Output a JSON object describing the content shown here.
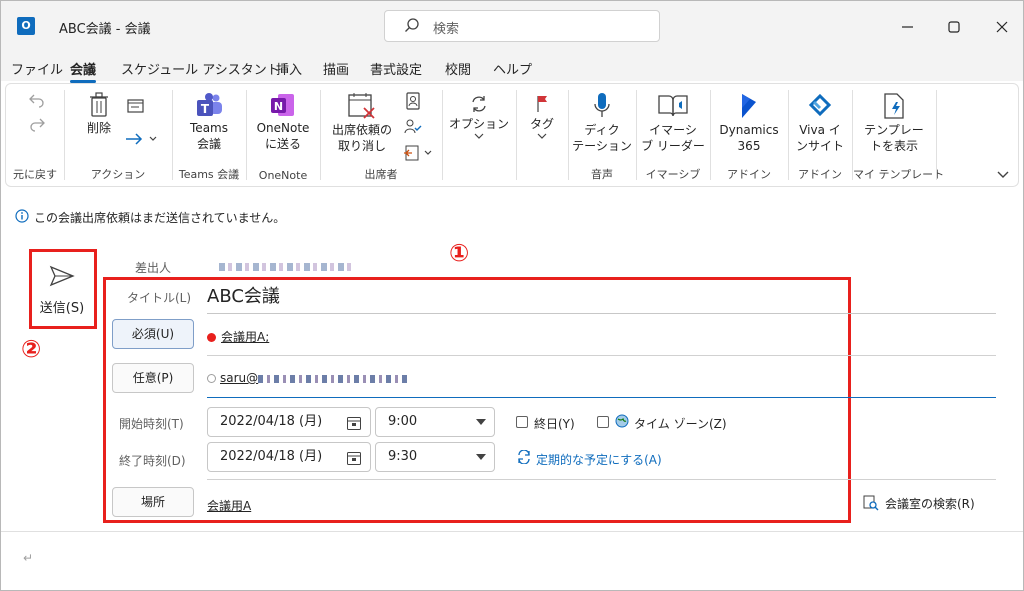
{
  "window": {
    "title": "ABC会議 - 会議",
    "search_placeholder": "検索",
    "app_icon_letter": "O"
  },
  "menu": {
    "tabs": [
      "ファイル",
      "会議",
      "スケジュール アシスタント",
      "挿入",
      "描画",
      "書式設定",
      "校閲",
      "ヘルプ"
    ],
    "active": "会議"
  },
  "ribbon": {
    "groups": {
      "undo": "元に戻す",
      "action": "アクション",
      "teams": "Teams 会議",
      "onenote": "OneNote",
      "attendees": "出席者",
      "voice": "音声",
      "immersive": "イマーシブ",
      "addin1": "アドイン",
      "addin2": "アドイン",
      "mytemplates": "マイ テンプレート"
    },
    "buttons": {
      "delete": "削除",
      "teams_line1": "Teams",
      "teams_line2": "会議",
      "onenote_line1": "OneNote",
      "onenote_line2": "に送る",
      "cancel_invite_line1": "出席依頼の",
      "cancel_invite_line2": "取り消し",
      "options": "オプション",
      "tags": "タグ",
      "dictate_line1": "ディク",
      "dictate_line2": "テーション",
      "immersive_line1": "イマーシ",
      "immersive_line2": "ブ リーダー",
      "dynamics_line1": "Dynamics",
      "dynamics_line2": "365",
      "viva_line1": "Viva イ",
      "viva_line2": "ンサイト",
      "template_line1": "テンプレー",
      "template_line2": "トを表示"
    }
  },
  "info_bar": "この会議出席依頼はまだ送信されていません。",
  "send_button": "送信(S)",
  "annotations": {
    "one": "①",
    "two": "②"
  },
  "colors": {
    "accent": "#0f6cbd",
    "annotation_red": "#e8201d"
  },
  "form": {
    "from_label": "差出人",
    "title_label": "タイトル(L)",
    "title_value": "ABC会議",
    "required_button": "必須(U)",
    "required_value": "会議用A;",
    "optional_button": "任意(P)",
    "optional_value_prefix": "saru@",
    "start_label": "開始時刻(T)",
    "start_date": "2022/04/18 (月)",
    "start_time": "9:00",
    "end_label": "終了時刻(D)",
    "end_date": "2022/04/18 (月)",
    "end_time": "9:30",
    "all_day": "終日(Y)",
    "time_zone": "タイム ゾーン(Z)",
    "recurrence": "定期的な予定にする(A)",
    "location_button": "場所",
    "location_value": "会議用A",
    "room_finder": "会議室の検索(R)"
  },
  "body_text": "↵"
}
